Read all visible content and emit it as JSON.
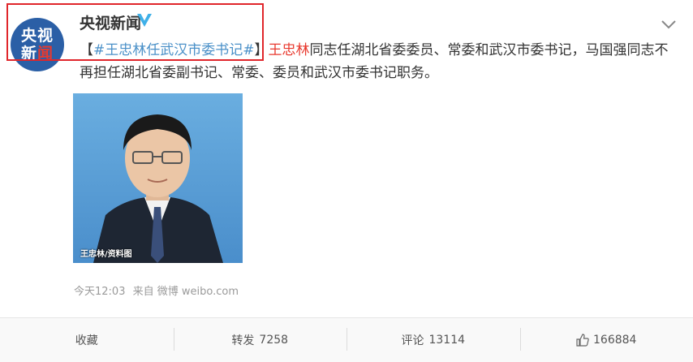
{
  "account": {
    "name": "央视新闻",
    "avatar_line1": "央视",
    "avatar_line2_a": "新",
    "avatar_line2_b": "闻"
  },
  "post": {
    "bracket_open": "【",
    "topic": "#王忠林任武汉市委书记#",
    "bracket_close": "】",
    "mention": "王忠林",
    "body": "同志任湖北省委委员、常委和武汉市委书记，马国强同志不再担任湖北省委副书记、常委、委员和武汉市委书记职务。",
    "photo_caption": "王忠林/资料图",
    "time": "今天12:03",
    "source": "来自 微博 weibo.com"
  },
  "actions": {
    "favorite_label": "收藏",
    "repost_label": "转发",
    "repost_count": "7258",
    "comment_label": "评论",
    "comment_count": "13114",
    "like_count": "166884"
  },
  "colors": {
    "highlight_border": "#e0262b",
    "topic_link": "#4a90c8",
    "mention": "#e8392e",
    "verified": "#3fb0e8"
  },
  "icons": [
    "verified-icon",
    "chevron-down-icon",
    "thumbs-up-icon"
  ]
}
